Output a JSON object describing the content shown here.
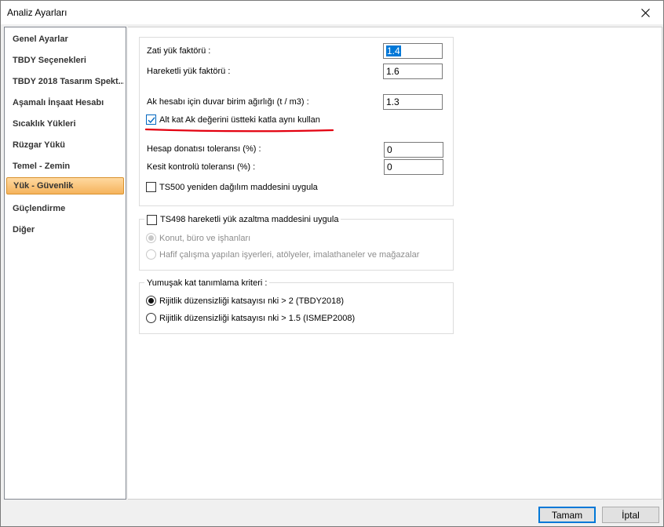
{
  "window": {
    "title": "Analiz Ayarları"
  },
  "sidebar": {
    "items": [
      {
        "label": "Genel Ayarlar"
      },
      {
        "label": "TBDY Seçenekleri"
      },
      {
        "label": "TBDY 2018 Tasarım Spekt..."
      },
      {
        "label": "Aşamalı İnşaat Hesabı"
      },
      {
        "label": "Sıcaklık Yükleri"
      },
      {
        "label": "Rüzgar Yükü"
      },
      {
        "label": "Temel - Zemin"
      },
      {
        "label": "Yük - Güvenlik"
      },
      {
        "label": "Güçlendirme"
      },
      {
        "label": "Diğer"
      }
    ],
    "selected": "Yük - Güvenlik"
  },
  "factors": {
    "dead_load_label": "Zati yük faktörü :",
    "dead_load_value": "1.4",
    "live_load_label": "Hareketli yük faktörü :",
    "live_load_value": "1.6",
    "wall_weight_label": "Ak hesabı için duvar birim ağırlığı (t / m3) :",
    "wall_weight_value": "1.3",
    "use_upper_floor_label": "Alt kat  Ak değerini üstteki katla aynı kullan",
    "use_upper_floor_checked": true,
    "rebar_tolerance_label": "Hesap donatısı toleransı (%) :",
    "rebar_tolerance_value": "0",
    "section_tolerance_label": "Kesit kontrolü toleransı (%) :",
    "section_tolerance_value": "0",
    "ts500_label": "TS500 yeniden dağılım maddesini uygula",
    "ts500_checked": false
  },
  "ts498": {
    "label": "TS498 hareketli yük azaltma maddesini uygula",
    "checked": false,
    "option1": "Konut, büro ve işhanları",
    "option2": "Hafif çalışma yapılan işyerleri, atölyeler, imalathaneler ve mağazalar"
  },
  "soft_story": {
    "title": "Yumuşak kat tanımlama kriteri :",
    "option1": "Rijitlik düzensizliği katsayısı nki > 2 (TBDY2018)",
    "option2": "Rijitlik düzensizliği katsayısı nki > 1.5 (ISMEP2008)",
    "selected": 1
  },
  "buttons": {
    "ok": "Tamam",
    "cancel": "İptal"
  },
  "colors": {
    "accent": "#0078d7",
    "selected_item": "#f5b35c",
    "annotation": "#e3000f"
  }
}
